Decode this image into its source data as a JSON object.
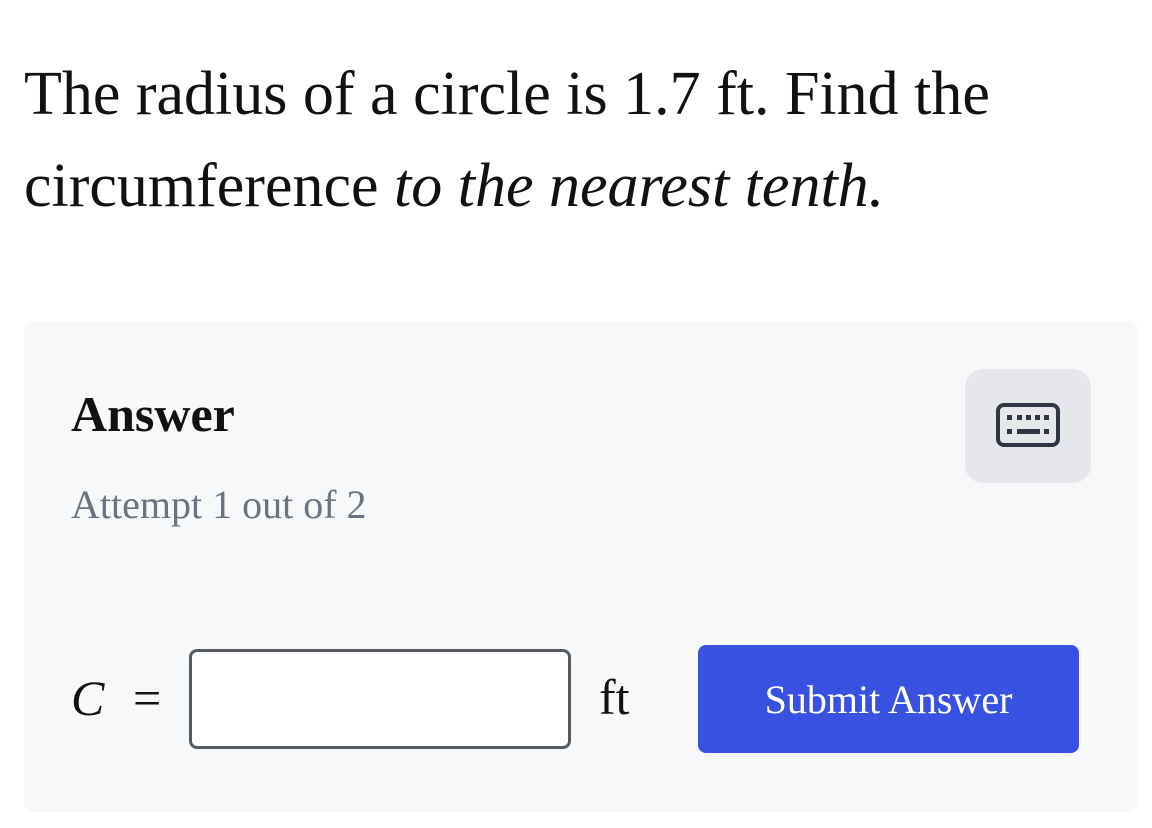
{
  "question": {
    "text_before": "The radius of a circle is 1.7 ft. Find the circumference ",
    "text_emphasis": "to the nearest tenth."
  },
  "answer_panel": {
    "heading": "Answer",
    "attempt_text": "Attempt 1 out of 2",
    "keyboard_button_icon": "keyboard-icon",
    "formula": {
      "variable": "C",
      "equals": "=",
      "input_value": "",
      "unit": "ft"
    },
    "submit_label": "Submit Answer"
  },
  "colors": {
    "panel_background": "#f7f8fa",
    "submit_button": "#3851e0",
    "keyboard_button_background": "#e5e7eb",
    "muted_text": "#6b7280"
  }
}
